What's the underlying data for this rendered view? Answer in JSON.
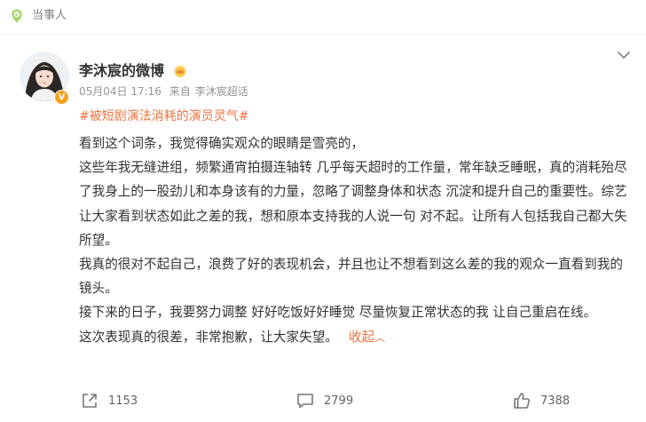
{
  "topbar": {
    "label": "当事人"
  },
  "post": {
    "username": "李沐宸的微博",
    "date": "05月04日 17:16",
    "source_prefix": "来自",
    "source": "李沐宸超话",
    "hashtag": "#被短剧演法消耗的演员灵气#",
    "paragraphs": [
      "看到这个词条，我觉得确实观众的眼睛是雪亮的，",
      "这些年我无缝进组，频繁通宵拍摄连轴转 几乎每天超时的工作量，常年缺乏睡眠，真的消耗殆尽了我身上的一股劲儿和本身该有的力量，忽略了调整身体和状态 沉淀和提升自己的重要性。综艺让大家看到状态如此之差的我，想和原本支持我的人说一句 对不起。让所有人包括我自己都大失所望。",
      "我真的很对不起自己，浪费了好的表现机会，并且也让不想看到这么差的我的观众一直看到我的镜头。",
      "接下来的日子，我要努力调整 好好吃饭好好睡觉 尽量恢复正常状态的我 让自己重启在线。"
    ],
    "last_paragraph": "这次表现真的很差，非常抱歉，让大家失望。",
    "collapse_label": "收起",
    "collapse_chevron": "︿"
  },
  "actions": {
    "repost_count": "1153",
    "comment_count": "2799",
    "like_count": "7388"
  },
  "colors": {
    "accent": "#eb7340",
    "text": "#333333",
    "meta": "#939393"
  }
}
